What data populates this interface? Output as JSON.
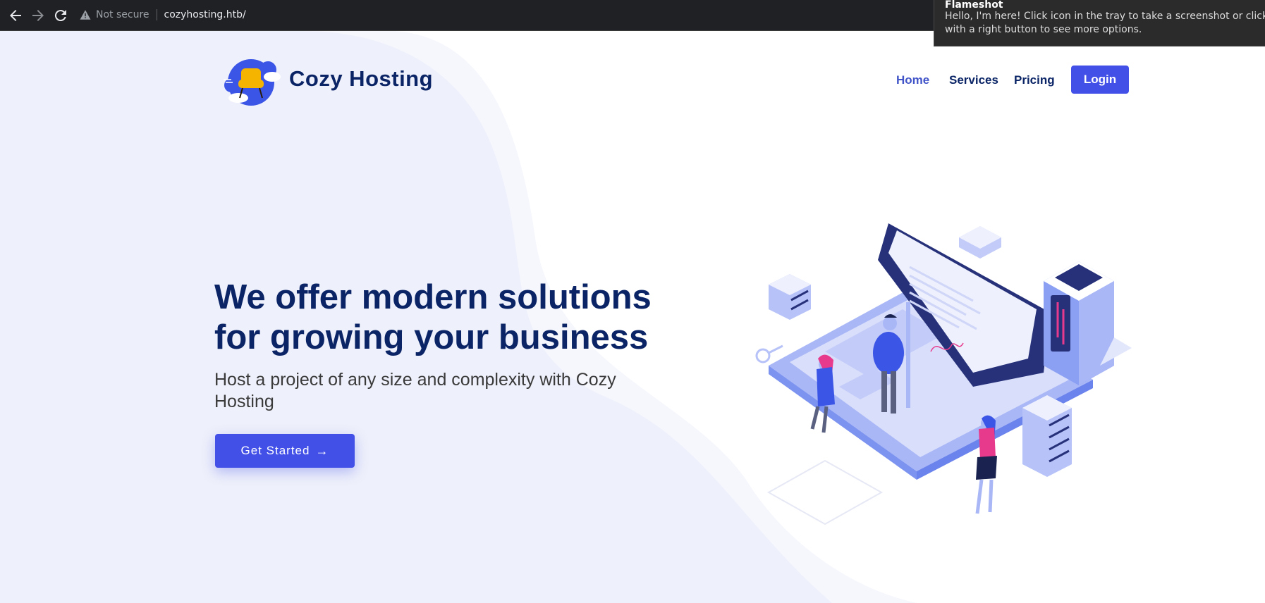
{
  "browser": {
    "security_label": "Not secure",
    "url": "cozyhosting.htb/"
  },
  "notification": {
    "title": "Flameshot",
    "body": "Hello, I'm here! Click icon in the tray to take a screenshot or click with a right button to see more options."
  },
  "site": {
    "brand": "Cozy Hosting",
    "nav": [
      "Home",
      "Services",
      "Pricing"
    ],
    "login_label": "Login"
  },
  "hero": {
    "title": "We offer modern solutions for growing your business",
    "subtitle": "Host a project of any size and complexity with Cozy Hosting",
    "cta_label": "Get Started",
    "cta_arrow": "→"
  },
  "colors": {
    "primary": "#4250e8",
    "heading": "#0a2466",
    "chrome": "#202124"
  }
}
